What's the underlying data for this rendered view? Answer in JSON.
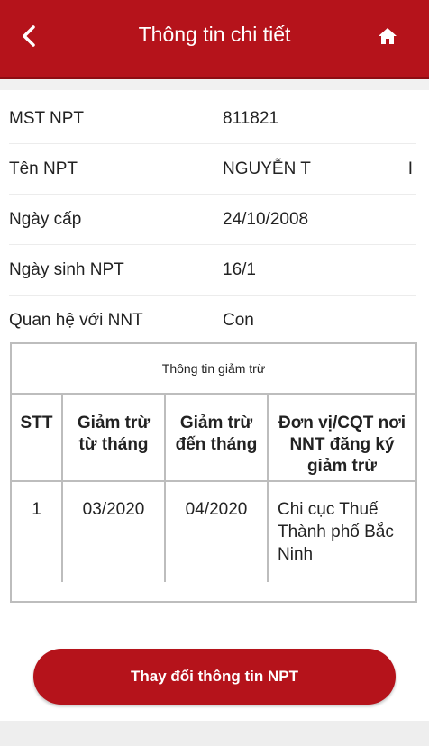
{
  "header": {
    "title": "Thông tin chi tiết",
    "back_icon": "chevron-left-icon",
    "home_icon": "home-icon"
  },
  "details": [
    {
      "label": "MST NPT",
      "value": "811821",
      "tail": ""
    },
    {
      "label": "Tên NPT",
      "value": "NGUYỄN T",
      "tail": "I"
    },
    {
      "label": "Ngày cấp",
      "value": "24/10/2008",
      "tail": ""
    },
    {
      "label": "Ngày sinh NPT",
      "value": "16/1",
      "tail": ""
    },
    {
      "label": "Quan hệ với NNT",
      "value": "Con",
      "tail": ""
    }
  ],
  "deduction": {
    "title": "Thông tin giảm trừ",
    "columns": [
      "STT",
      "Giảm trừ từ tháng",
      "Giảm trừ đến tháng",
      "Đơn vị/CQT nơi NNT đăng ký giảm trừ"
    ],
    "rows": [
      {
        "stt": "1",
        "from": "03/2020",
        "to": "04/2020",
        "unit": "Chi cục Thuế Thành phố Bắc Ninh"
      }
    ]
  },
  "action": {
    "label": "Thay đổi thông tin NPT"
  },
  "colors": {
    "primary": "#b5131b",
    "border": "#bdbdbd"
  }
}
